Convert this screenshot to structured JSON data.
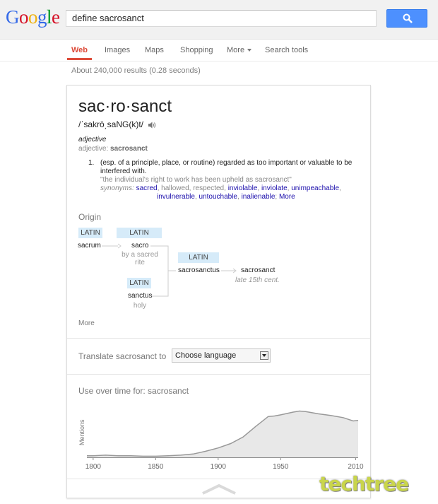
{
  "header": {
    "logo_letters": [
      {
        "char": "G",
        "color": "#3369e8"
      },
      {
        "char": "o",
        "color": "#d50f25"
      },
      {
        "char": "o",
        "color": "#eeb211"
      },
      {
        "char": "g",
        "color": "#3369e8"
      },
      {
        "char": "l",
        "color": "#009925"
      },
      {
        "char": "e",
        "color": "#d50f25"
      }
    ],
    "query": "define sacrosanct",
    "search_icon": "search-icon"
  },
  "nav": {
    "items": [
      "Web",
      "Images",
      "Maps",
      "Shopping",
      "More",
      "Search tools"
    ],
    "active": "Web"
  },
  "results_stats": "About 240,000 results (0.28 seconds)",
  "definition": {
    "word": "sac·ro·sanct",
    "phonetic": "/ˈsakrō͵saNG(k)t/",
    "audio_icon": "speaker-icon",
    "part_of_speech": "adjective",
    "pos_label": "adjective:",
    "pos_word": "sacrosanct",
    "sense_number": "1.",
    "sense_text": "(esp. of a principle, place, or routine) regarded as too important or valuable to be interfered with.",
    "example": "\"the individual's right to work has been upheld as sacrosanct\"",
    "synonyms_label": "synonyms:",
    "synonyms": [
      {
        "word": "sacred",
        "link": true
      },
      {
        "word": "hallowed",
        "link": false
      },
      {
        "word": "respected",
        "link": false
      },
      {
        "word": "inviolable",
        "link": true
      },
      {
        "word": "inviolate",
        "link": true
      },
      {
        "word": "unimpeachable",
        "link": true
      },
      {
        "word": "invulnerable",
        "link": true
      },
      {
        "word": "untouchable",
        "link": true
      },
      {
        "word": "inalienable",
        "link": true
      }
    ],
    "synonyms_more": "More"
  },
  "origin": {
    "title": "Origin",
    "lang1": "LATIN",
    "lang2": "LATIN",
    "lang3": "LATIN",
    "lang4": "LATIN",
    "word1": "sacrum",
    "word2": "sacro",
    "gloss2": "by a sacred rite",
    "word3": "sanctus",
    "gloss3": "holy",
    "word4": "sacrosanctus",
    "word5": "sacrosanct",
    "note5": "late 15th cent.",
    "more": "More"
  },
  "translate": {
    "label": "Translate sacrosanct to",
    "select_value": "Choose language"
  },
  "usage": {
    "title": "Use over time for: sacrosanct",
    "chart_data": {
      "type": "area",
      "title": "Use over time for: sacrosanct",
      "ylabel": "Mentions",
      "xlabel": "",
      "x_ticks": [
        1800,
        1850,
        1900,
        1950,
        2010
      ],
      "xlim": [
        1795,
        2012
      ],
      "ylim": [
        0,
        100
      ],
      "x": [
        1795,
        1800,
        1810,
        1820,
        1830,
        1840,
        1850,
        1860,
        1870,
        1880,
        1890,
        1900,
        1910,
        1920,
        1930,
        1940,
        1945,
        1950,
        1960,
        1965,
        1970,
        1980,
        1990,
        2000,
        2008,
        2012
      ],
      "values": [
        3,
        3,
        4,
        3,
        3,
        2,
        2,
        3,
        4,
        6,
        11,
        17,
        25,
        37,
        56,
        74,
        75,
        77,
        82,
        84,
        83,
        79,
        76,
        72,
        66,
        67
      ]
    }
  },
  "watermark": "techtree"
}
